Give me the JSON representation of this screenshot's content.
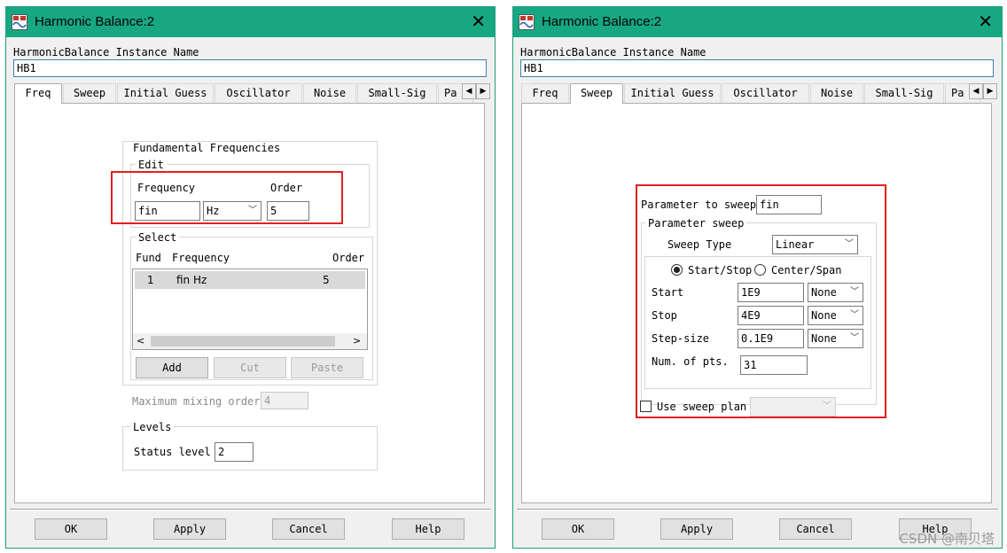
{
  "dialogs": [
    {
      "title": "Harmonic Balance:2",
      "instance_label": "HarmonicBalance Instance Name",
      "instance_value": "HB1",
      "tabs": [
        "Freq",
        "Sweep",
        "Initial Guess",
        "Oscillator",
        "Noise",
        "Small-Sig",
        "Pa"
      ],
      "active_tab": "Freq",
      "footer": {
        "ok": "OK",
        "apply": "Apply",
        "cancel": "Cancel",
        "help": "Help"
      }
    },
    {
      "title": "Harmonic Balance:2",
      "instance_label": "HarmonicBalance Instance Name",
      "instance_value": "HB1",
      "tabs": [
        "Freq",
        "Sweep",
        "Initial Guess",
        "Oscillator",
        "Noise",
        "Small-Sig",
        "Pa"
      ],
      "active_tab": "Sweep",
      "footer": {
        "ok": "OK",
        "apply": "Apply",
        "cancel": "Cancel",
        "help": "Help"
      }
    }
  ],
  "freq": {
    "fund_group": "Fundamental Frequencies",
    "edit_group": "Edit",
    "frequency_label": "Frequency",
    "order_label": "Order",
    "frequency_value": "fin",
    "unit_value": "Hz",
    "order_value": "5",
    "select_group": "Select",
    "col_fund": "Fund",
    "col_frequency": "Frequency",
    "col_order": "Order",
    "rows": [
      {
        "fund": "1",
        "frequency": "fin Hz",
        "order": "5"
      }
    ],
    "add": "Add",
    "cut": "Cut",
    "paste": "Paste",
    "max_mix_label": "Maximum mixing order",
    "max_mix_value": "4",
    "levels_group": "Levels",
    "status_label": "Status level",
    "status_value": "2"
  },
  "sweep": {
    "param_label": "Parameter to sweep",
    "param_value": "fin",
    "group": "Parameter sweep",
    "sweep_type_label": "Sweep Type",
    "sweep_type_value": "Linear",
    "radio_start_stop": "Start/Stop",
    "radio_center_span": "Center/Span",
    "start_label": "Start",
    "start_value": "1E9",
    "start_unit": "None",
    "stop_label": "Stop",
    "stop_value": "4E9",
    "stop_unit": "None",
    "step_label": "Step-size",
    "step_value": "0.1E9",
    "step_unit": "None",
    "num_pts_label": "Num. of pts.",
    "num_pts_value": "31",
    "use_plan_label": "Use sweep plan"
  },
  "watermark": "CSDN @南贝塔",
  "colors": {
    "titlebar": "#17a883",
    "highlight_box": "#e02020",
    "selected_row": "#d9d9d9"
  }
}
